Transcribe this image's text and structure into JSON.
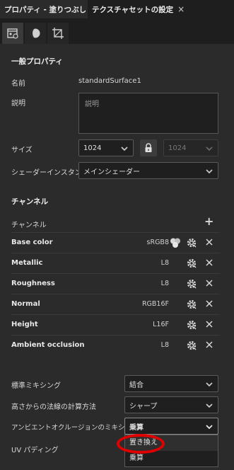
{
  "tabs": [
    {
      "label": "プロパティ - 塗りつぶし",
      "active": true
    },
    {
      "label": "テクスチャセットの設定",
      "active": false
    }
  ],
  "tab_close_glyph": "×",
  "icons": [
    "texture-set-settings-icon",
    "material-sphere-icon",
    "crop-uv-icon"
  ],
  "general": {
    "title": "一般プロパティ",
    "name_label": "名前",
    "name_value": "standardSurface1",
    "desc_label": "説明",
    "desc_placeholder": "説明",
    "size_label": "サイズ",
    "size_value": "1024",
    "size_value2": "1024",
    "shader_label": "シェーダーインスタンス",
    "shader_value": "メインシェーダー"
  },
  "channels": {
    "title": "チャンネル",
    "channel_label": "チャンネル",
    "add_glyph": "+",
    "rows": [
      {
        "name": "Base color",
        "format": "sRGB8",
        "mix_icon": true
      },
      {
        "name": "Metallic",
        "format": "L8"
      },
      {
        "name": "Roughness",
        "format": "L8"
      },
      {
        "name": "Normal",
        "format": "RGB16F"
      },
      {
        "name": "Height",
        "format": "L16F"
      },
      {
        "name": "Ambient occlusion",
        "format": "L8"
      }
    ]
  },
  "settings": {
    "blend_label": "標準ミキシング",
    "blend_value": "結合",
    "normal_label": "高さからの法線の計算方法",
    "normal_value": "シャープ",
    "ao_label": "アンビエントオクルージョンのミキシング",
    "ao_value": "乗算",
    "uv_label": "UV パディング"
  },
  "dropdown_menu": {
    "options": [
      "置き換え",
      "乗算"
    ],
    "highlighted": "置き換え"
  },
  "colors": {
    "background": "#2b2b2b",
    "tabbar": "#1e1e1e",
    "annotation_circle": "#e00000"
  }
}
